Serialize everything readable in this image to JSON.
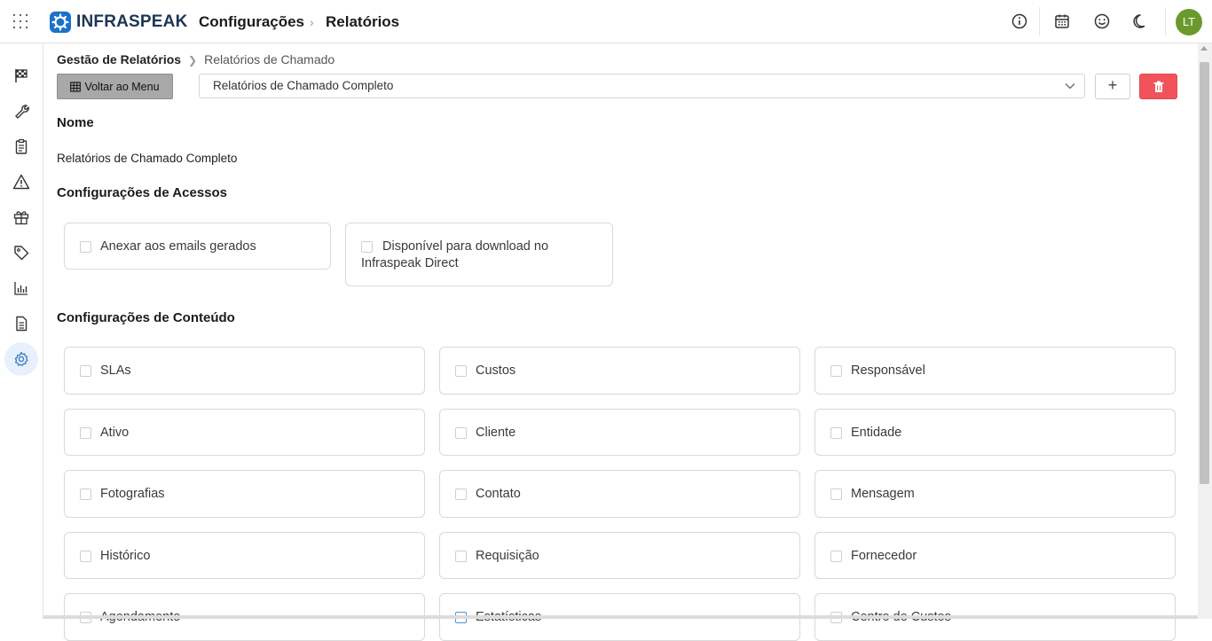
{
  "topbar": {
    "brand": "INFRASPEAK",
    "crumb_1": "Configurações",
    "crumb_2": "Relatórios",
    "crumb_sep": "›",
    "icons": [
      "info-icon",
      "calendar-icon",
      "smile-icon",
      "moon-icon"
    ],
    "avatar_initials": "LT",
    "avatar_color": "#6a9a2c"
  },
  "sidebar": {
    "items": [
      "flag-icon",
      "wrench-icon",
      "clipboard-icon",
      "warning-icon",
      "gift-icon",
      "tag-icon",
      "chart-icon",
      "document-icon",
      "settings-icon"
    ],
    "active": "settings-icon"
  },
  "breadcrumb": {
    "root": "Gestão de Relatórios",
    "current": "Relatórios de Chamado"
  },
  "toolbar": {
    "back_label": "Voltar ao Menu",
    "selected_report": "Relatórios de Chamado Completo",
    "add_label": "+"
  },
  "name_section": {
    "title": "Nome",
    "value": "Relatórios de Chamado Completo"
  },
  "access_section": {
    "title": "Configurações de Acessos",
    "options": [
      {
        "label": "Anexar aos emails gerados",
        "checked": false
      },
      {
        "label": "Disponível para download no Infraspeak Direct",
        "checked": false
      }
    ]
  },
  "content_section": {
    "title": "Configurações de Conteúdo",
    "options": [
      {
        "label": "SLAs",
        "checked": false
      },
      {
        "label": "Custos",
        "checked": false
      },
      {
        "label": "Responsável",
        "checked": false
      },
      {
        "label": "Ativo",
        "checked": false
      },
      {
        "label": "Cliente",
        "checked": false
      },
      {
        "label": "Entidade",
        "checked": false
      },
      {
        "label": "Fotografias",
        "checked": false
      },
      {
        "label": "Contato",
        "checked": false
      },
      {
        "label": "Mensagem",
        "checked": false
      },
      {
        "label": "Histórico",
        "checked": false
      },
      {
        "label": "Requisição",
        "checked": false
      },
      {
        "label": "Fornecedor",
        "checked": false
      },
      {
        "label": "Agendamento",
        "checked": false
      },
      {
        "label": "Estatísticas",
        "checked": false
      },
      {
        "label": "Centro de Custos",
        "checked": false
      }
    ]
  },
  "colors": {
    "accent": "#1a73c8",
    "delete": "#f0545a",
    "back_button": "#a8a8a8"
  }
}
